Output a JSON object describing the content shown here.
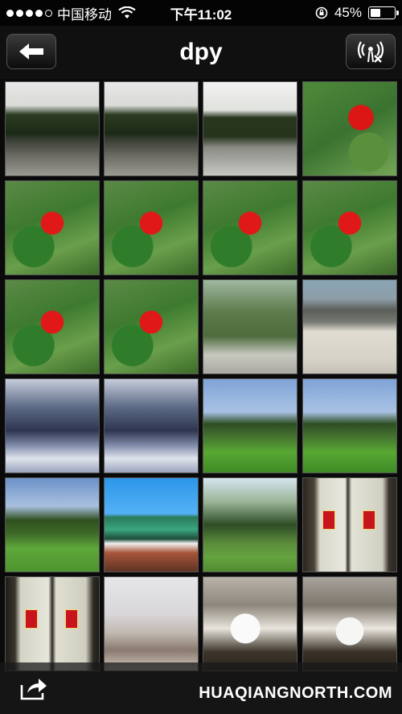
{
  "status_bar": {
    "carrier": "中国移动",
    "time": "下午11:02",
    "battery_percent": "45%",
    "battery_level": 0.45,
    "signal_bars_filled": 4,
    "signal_bars_total": 5
  },
  "nav": {
    "title": "dpy",
    "back_icon": "back-arrow-icon",
    "right_icon": "wireless-off-icon"
  },
  "photos": [
    {
      "id": "p1",
      "style": "avenue"
    },
    {
      "id": "p2",
      "style": "avenue"
    },
    {
      "id": "p3",
      "style": "avenue2"
    },
    {
      "id": "p4",
      "style": "rose2"
    },
    {
      "id": "p5",
      "style": "rose"
    },
    {
      "id": "p6",
      "style": "rose"
    },
    {
      "id": "p7",
      "style": "rose"
    },
    {
      "id": "p8",
      "style": "rose"
    },
    {
      "id": "p9",
      "style": "rose"
    },
    {
      "id": "p10",
      "style": "rose"
    },
    {
      "id": "p11",
      "style": "park"
    },
    {
      "id": "p12",
      "style": "building"
    },
    {
      "id": "p13",
      "style": "blue-trees"
    },
    {
      "id": "p14",
      "style": "blue-trees"
    },
    {
      "id": "p15",
      "style": "lawn"
    },
    {
      "id": "p16",
      "style": "lawn"
    },
    {
      "id": "p17",
      "style": "temple"
    },
    {
      "id": "p18",
      "style": "roof"
    },
    {
      "id": "p19",
      "style": "trees-lawn"
    },
    {
      "id": "p20",
      "style": "window"
    },
    {
      "id": "p21",
      "style": "window2"
    },
    {
      "id": "p22",
      "style": "room"
    },
    {
      "id": "p23",
      "style": "coffee"
    },
    {
      "id": "p24",
      "style": "coffee2"
    }
  ],
  "toolbar": {
    "share_icon": "share-icon"
  },
  "watermark": "HUAQIANGNORTH.COM"
}
